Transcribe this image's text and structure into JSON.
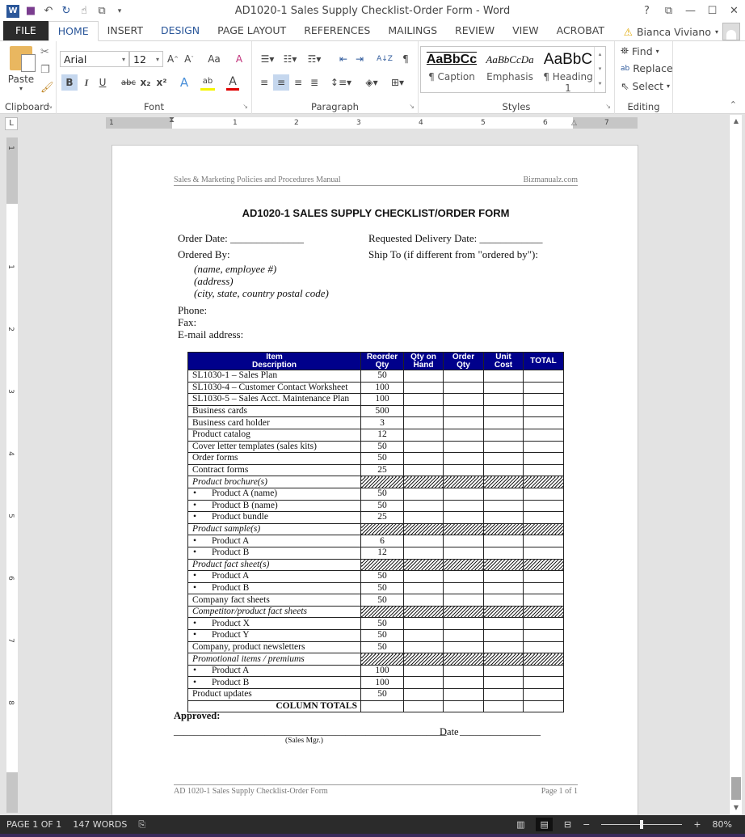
{
  "window": {
    "title": "AD1020-1 Sales Supply Checklist-Order Form - Word",
    "controls": {
      "help": "?",
      "restore_ribbon": "⧉",
      "minimize": "—",
      "maximize": "☐",
      "close": "✕"
    }
  },
  "quick_access": {
    "app_icon": "W",
    "save": "💾",
    "undo": "↶",
    "redo": "↻",
    "touch": "☝",
    "copy_fmt": "⧉",
    "customize": "▾"
  },
  "tabs": [
    "FILE",
    "HOME",
    "INSERT",
    "DESIGN",
    "PAGE LAYOUT",
    "REFERENCES",
    "MAILINGS",
    "REVIEW",
    "VIEW",
    "ACROBAT"
  ],
  "active_tab": "HOME",
  "user": {
    "name": "Bianca Viviano",
    "warning_icon": "⚠"
  },
  "ribbon": {
    "clipboard": {
      "label": "Clipboard",
      "paste": "Paste"
    },
    "font": {
      "label": "Font",
      "font_name": "Arial",
      "font_size": "12",
      "grow": "A˄",
      "shrink": "A˅",
      "case": "Aa",
      "bold": "B",
      "italic": "I",
      "underline": "U",
      "strike": "abc",
      "subscript": "x₂",
      "superscript": "x²",
      "effects": "A",
      "highlight": "ab",
      "color": "A"
    },
    "paragraph": {
      "label": "Paragraph",
      "show_marks": "¶",
      "sort": "A↓Z"
    },
    "styles": {
      "label": "Styles",
      "items": [
        {
          "preview": "AaBbCc",
          "name": "¶ Caption"
        },
        {
          "preview": "AaBbCcDa",
          "name": "Emphasis"
        },
        {
          "preview": "AaBbC",
          "name": "¶ Heading 1"
        }
      ]
    },
    "editing": {
      "label": "Editing",
      "find": "Find",
      "replace": "Replace",
      "select": "Select"
    }
  },
  "ruler": {
    "h_numbers": [
      "1",
      "1",
      "2",
      "3",
      "4",
      "5",
      "6",
      "7"
    ],
    "v_numbers": [
      "1",
      "1",
      "2",
      "3",
      "4",
      "5",
      "6",
      "7",
      "8"
    ],
    "tab_selector": "L"
  },
  "document": {
    "header_left": "Sales & Marketing Policies and Procedures Manual",
    "header_right": "Bizmanualz.com",
    "title": "AD1020-1 SALES SUPPLY CHECKLIST/ORDER FORM",
    "order_date": "Order Date: ______________",
    "requested_delivery": "Requested Delivery Date: ____________",
    "ordered_by": "Ordered By:",
    "ship_to": "Ship To (if different from \"ordered by\"):",
    "ordered_by_lines": [
      "(name, employee #)",
      "(address)",
      "(city, state, country postal code)"
    ],
    "phone": "Phone:",
    "fax": "Fax:",
    "email": "E-mail address:",
    "table": {
      "headers": [
        "Item\nDescription",
        "Reorder\nQty",
        "Qty on\nHand",
        "Order\nQty",
        "Unit\nCost",
        "TOTAL"
      ],
      "rows": [
        {
          "type": "item",
          "desc": "SL1030-1 – Sales Plan",
          "qty": "50"
        },
        {
          "type": "item",
          "desc": "SL1030-4 – Customer Contact Worksheet",
          "qty": "100"
        },
        {
          "type": "item",
          "desc": "SL1030-5 – Sales Acct. Maintenance Plan",
          "qty": "100"
        },
        {
          "type": "item",
          "desc": "Business cards",
          "qty": "500"
        },
        {
          "type": "item",
          "desc": "Business card holder",
          "qty": "3"
        },
        {
          "type": "item",
          "desc": "Product catalog",
          "qty": "12"
        },
        {
          "type": "item",
          "desc": "Cover letter templates (sales kits)",
          "qty": "50"
        },
        {
          "type": "item",
          "desc": "Order forms",
          "qty": "50"
        },
        {
          "type": "item",
          "desc": "Contract forms",
          "qty": "25"
        },
        {
          "type": "section",
          "desc": "Product brochure(s)"
        },
        {
          "type": "bullet",
          "desc": "Product A (name)",
          "qty": "50"
        },
        {
          "type": "bullet",
          "desc": "Product B (name)",
          "qty": "50"
        },
        {
          "type": "bullet",
          "desc": "Product bundle",
          "qty": "25"
        },
        {
          "type": "section",
          "desc": "Product sample(s)"
        },
        {
          "type": "bullet",
          "desc": "Product A",
          "qty": "6"
        },
        {
          "type": "bullet",
          "desc": "Product B",
          "qty": "12"
        },
        {
          "type": "section",
          "desc": "Product fact sheet(s)"
        },
        {
          "type": "bullet",
          "desc": "Product A",
          "qty": "50"
        },
        {
          "type": "bullet",
          "desc": "Product B",
          "qty": "50"
        },
        {
          "type": "item",
          "desc": "Company fact sheets",
          "qty": "50"
        },
        {
          "type": "section",
          "desc": "Competitor/product fact sheets"
        },
        {
          "type": "bullet",
          "desc": "Product X",
          "qty": "50"
        },
        {
          "type": "bullet",
          "desc": "Product Y",
          "qty": "50"
        },
        {
          "type": "item",
          "desc": "Company, product newsletters",
          "qty": "50"
        },
        {
          "type": "section",
          "desc": "Promotional items / premiums"
        },
        {
          "type": "bullet",
          "desc": "Product A",
          "qty": "100"
        },
        {
          "type": "bullet",
          "desc": "Product B",
          "qty": "100"
        },
        {
          "type": "item",
          "desc": "Product updates",
          "qty": "50"
        },
        {
          "type": "total",
          "desc": "COLUMN TOTALS"
        }
      ]
    },
    "approved": "Approved:",
    "sig_line": "______________________________________________________",
    "date_label": "Date",
    "date_line": "________________",
    "sig_caption": "(Sales Mgr.)",
    "footer_left": "AD 1020-1 Sales Supply Checklist-Order Form",
    "footer_right": "Page 1 of 1"
  },
  "status_bar": {
    "page": "PAGE 1 OF 1",
    "words": "147 WORDS",
    "zoom": "80%",
    "zoom_minus": "−",
    "zoom_plus": "+"
  }
}
